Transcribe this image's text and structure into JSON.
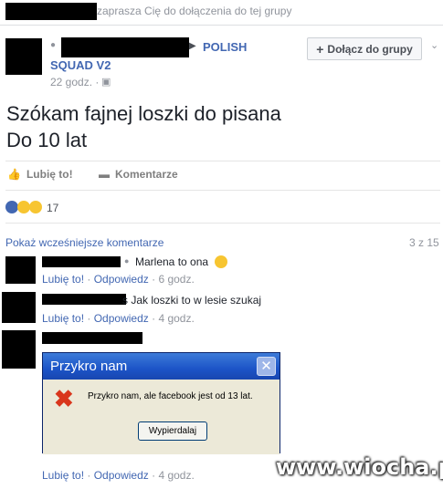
{
  "header": {
    "invite_text": "zaprasza Cię do dołączenia do tej grupy"
  },
  "post": {
    "group_name_part1": "POLISH",
    "group_name_part2": "SQUAD V2",
    "time": "22 godz. ·",
    "join_button": "Dołącz do grupy",
    "text_line1": "Szókam fajnej loszki do pisana",
    "text_line2": "Do 10 lat",
    "like_label": "Lubię to!",
    "comment_label": "Komentarze",
    "reactions_count": "17"
  },
  "comments": {
    "show_earlier": "Pokaż wcześniejsze komentarze",
    "pager": "3 z 15",
    "items": [
      {
        "text": "Marlena to ona",
        "like": "Lubię to!",
        "reply": "Odpowiedz",
        "time": "6 godz."
      },
      {
        "text": "s Jak loszki to w lesie szukaj",
        "like": "Lubię to!",
        "reply": "Odpowiedz",
        "time": "4 godz."
      },
      {
        "like": "Lubię to!",
        "reply": "Odpowiedz",
        "time": "4 godz."
      }
    ]
  },
  "dialog": {
    "title": "Przykro nam",
    "message": "Przykro nam, ale facebook jest od 13 lat.",
    "button": "Wypierdalaj"
  },
  "watermark": "www.wiocha.pl",
  "colors": {
    "link": "#4267b2",
    "meta": "#90949c",
    "dialog_title": "#1c54c7"
  }
}
